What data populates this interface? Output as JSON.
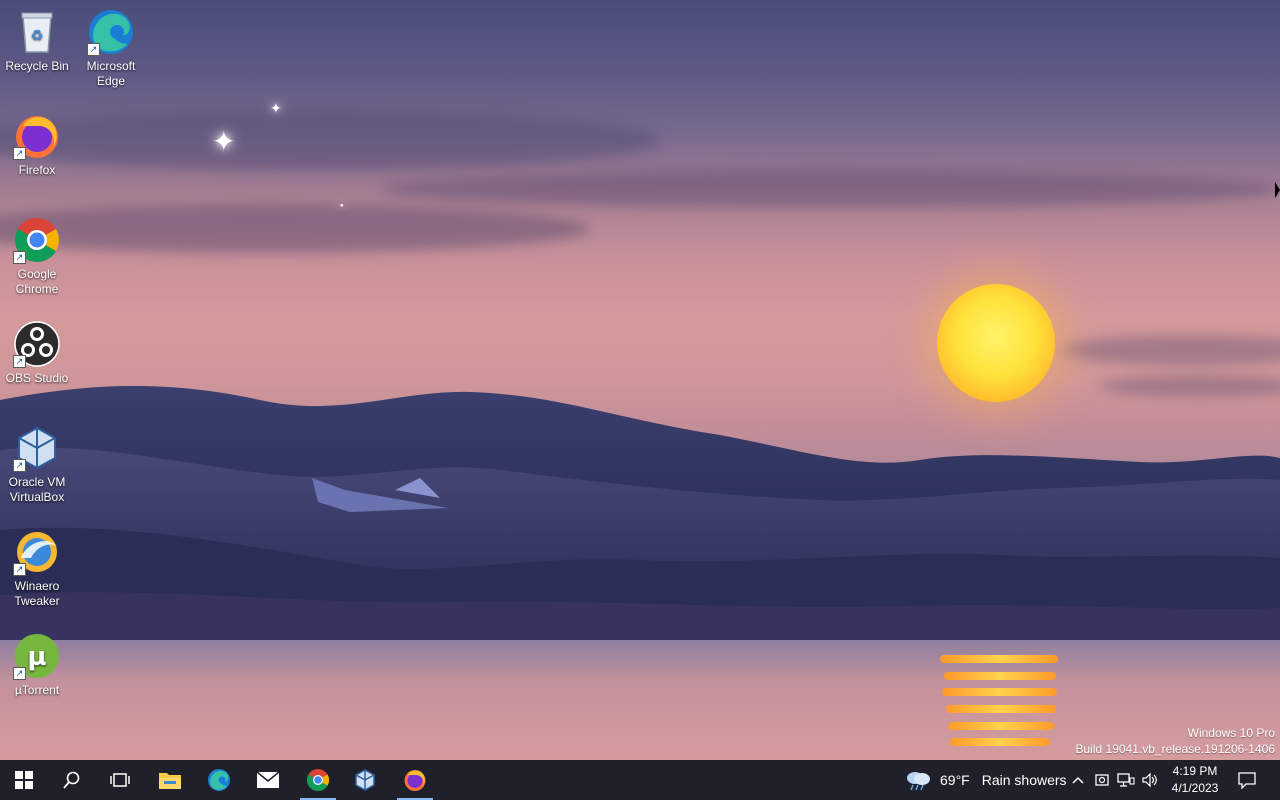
{
  "desktop": {
    "icons": [
      {
        "label": "Recycle Bin"
      },
      {
        "label": "Microsoft Edge"
      },
      {
        "label": "Firefox"
      },
      {
        "label": "Google Chrome"
      },
      {
        "label": "OBS Studio"
      },
      {
        "label": "Oracle VM VirtualBox"
      },
      {
        "label": "Winaero Tweaker"
      },
      {
        "label": "µTorrent"
      }
    ],
    "watermark": {
      "line1": "Windows 10 Pro",
      "line2": "Build 19041.vb_release.191206-1406"
    }
  },
  "taskbar": {
    "pinned": [
      "start-button",
      "search-button",
      "task-view-button",
      "file-explorer",
      "microsoft-edge",
      "mail",
      "google-chrome",
      "virtualbox",
      "firefox"
    ],
    "weather": {
      "temperature": "69°F",
      "condition": "Rain showers"
    },
    "clock": {
      "time": "4:19 PM",
      "date": "4/1/2023"
    }
  },
  "colors": {
    "taskbar_bg": "#20202a",
    "accent_underline": "#8ab4f8",
    "sun": "#ffd83a"
  }
}
